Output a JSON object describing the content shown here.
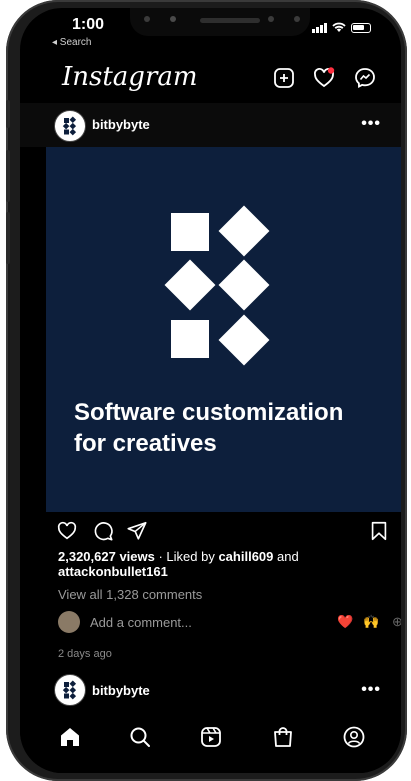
{
  "status_bar": {
    "time": "1:00",
    "back_label": "◂ Search"
  },
  "header": {
    "logo": "Instagram",
    "icons": [
      "add-post-icon",
      "heart-notification-icon",
      "messenger-icon"
    ],
    "notification_dot_color": "#ff3040"
  },
  "post": {
    "username": "bitbybyte",
    "image_caption_line1": "Software customization",
    "image_caption_line2": "for creatives",
    "image_background": "#0d1f3c",
    "views": "2,320,627 views",
    "liked_by_prefix": " · Liked by ",
    "liked_by_user": "cahill609",
    "liked_by_and": " and",
    "liked_by_user2": "attackonbullet161",
    "view_comments": "View all 1,328 comments",
    "add_comment_placeholder": "Add a comment...",
    "reaction_heart": "❤️",
    "reaction_hands": "🙌",
    "reaction_add": "⊕",
    "time_ago": "2 days ago"
  },
  "next_post": {
    "username": "bitbybyte"
  },
  "bottom_nav": {
    "items": [
      "home-icon",
      "search-icon",
      "reels-icon",
      "shop-icon",
      "profile-icon"
    ],
    "active": "home-icon"
  }
}
